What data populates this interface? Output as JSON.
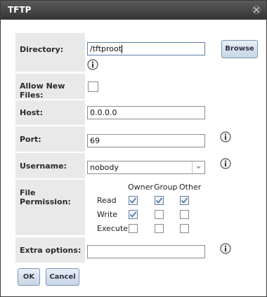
{
  "window": {
    "title": "TFTP",
    "close_icon": "close-icon"
  },
  "form": {
    "directory": {
      "label": "Directory:",
      "value": "/tftproot"
    },
    "browse_button": "Browse",
    "allow_new_files": {
      "label": "Allow New Files:",
      "checked": false
    },
    "host": {
      "label": "Host:",
      "value": "0.0.0.0"
    },
    "port": {
      "label": "Port:",
      "value": "69"
    },
    "username": {
      "label": "Username:",
      "value": "nobody"
    },
    "file_permission": {
      "label": "File Permission:",
      "columns": [
        "Owner",
        "Group",
        "Other"
      ],
      "rows": [
        {
          "label": "Read",
          "values": [
            true,
            true,
            true
          ]
        },
        {
          "label": "Write",
          "values": [
            true,
            false,
            false
          ]
        },
        {
          "label": "Execute",
          "values": [
            false,
            false,
            false
          ]
        }
      ]
    },
    "extra_options": {
      "label": "Extra options:",
      "value": ""
    }
  },
  "buttons": {
    "ok": "OK",
    "cancel": "Cancel"
  },
  "icons": {
    "info": "info-icon",
    "dropdown": "chevron-down-icon"
  },
  "colors": {
    "titlebar": "#3c3c3c",
    "label_background": "#e9e9e9",
    "button_border": "#7d96b5",
    "check_mark": "#4a6f9c"
  }
}
